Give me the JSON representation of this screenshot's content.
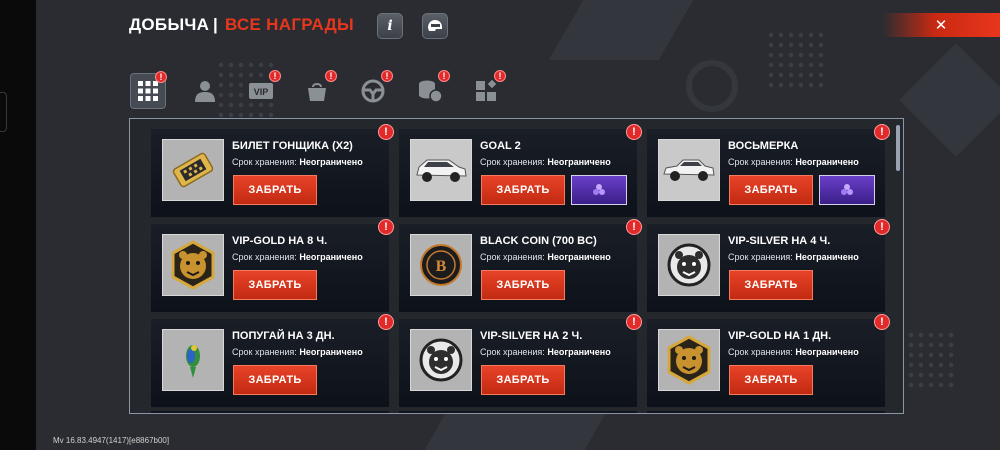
{
  "header": {
    "title": "ДОБЫЧА",
    "separator": "|",
    "subtitle": "ВСЕ НАГРАДЫ",
    "info_label": "i"
  },
  "tabs": [
    {
      "id": "all",
      "icon": "grid-icon",
      "badge": "!",
      "active": true
    },
    {
      "id": "profile",
      "icon": "person-icon",
      "badge": "",
      "active": false
    },
    {
      "id": "vip",
      "icon": "vip-icon",
      "label": "VIP",
      "badge": "!",
      "active": false
    },
    {
      "id": "bag",
      "icon": "bag-icon",
      "badge": "!",
      "active": false
    },
    {
      "id": "wheel",
      "icon": "steering-wheel-icon",
      "badge": "!",
      "active": false
    },
    {
      "id": "coins",
      "icon": "coins-icon",
      "badge": "!",
      "active": false
    },
    {
      "id": "blocks",
      "icon": "blocks-icon",
      "badge": "!",
      "active": false
    }
  ],
  "storage_label": "Срок хранения:",
  "claim_label": "ЗАБРАТЬ",
  "rewards": [
    {
      "name": "БИЛЕТ ГОНЩИКА (X2)",
      "storage": "Неограничено",
      "icon": "ticket-icon",
      "has_bonus": false,
      "badge": "!"
    },
    {
      "name": "GOAL 2",
      "storage": "Неограничено",
      "icon": "car-icon",
      "has_bonus": true,
      "badge": "!"
    },
    {
      "name": "ВОСЬМЕРКА",
      "storage": "Неограничено",
      "icon": "car-icon",
      "has_bonus": true,
      "badge": "!"
    },
    {
      "name": "VIP-GOLD НА 8 Ч.",
      "storage": "Неограничено",
      "icon": "gold-bear-icon",
      "has_bonus": false,
      "badge": "!"
    },
    {
      "name": "BLACK COIN (700 BC)",
      "storage": "Неограничено",
      "icon": "black-coin-icon",
      "has_bonus": false,
      "badge": "!"
    },
    {
      "name": "VIP-SILVER НА 4 Ч.",
      "storage": "Неограничено",
      "icon": "silver-bear-icon",
      "has_bonus": false,
      "badge": "!"
    },
    {
      "name": "ПОПУГАЙ НА 3 ДН.",
      "storage": "Неограничено",
      "icon": "parrot-icon",
      "has_bonus": false,
      "badge": "!"
    },
    {
      "name": "VIP-SILVER НА 2 Ч.",
      "storage": "Неограничено",
      "icon": "silver-bear-icon",
      "has_bonus": false,
      "badge": "!"
    },
    {
      "name": "VIP-GOLD НА 1 ДН.",
      "storage": "Неограничено",
      "icon": "gold-bear-icon",
      "has_bonus": false,
      "badge": "!"
    }
  ],
  "version": "Mv 16.83.4947(1417)[e8867b00]",
  "colors": {
    "accent": "#e8361c",
    "badge": "#e32a2a",
    "panel_border": "#8a95a6",
    "bonus": "#5b35b8"
  }
}
